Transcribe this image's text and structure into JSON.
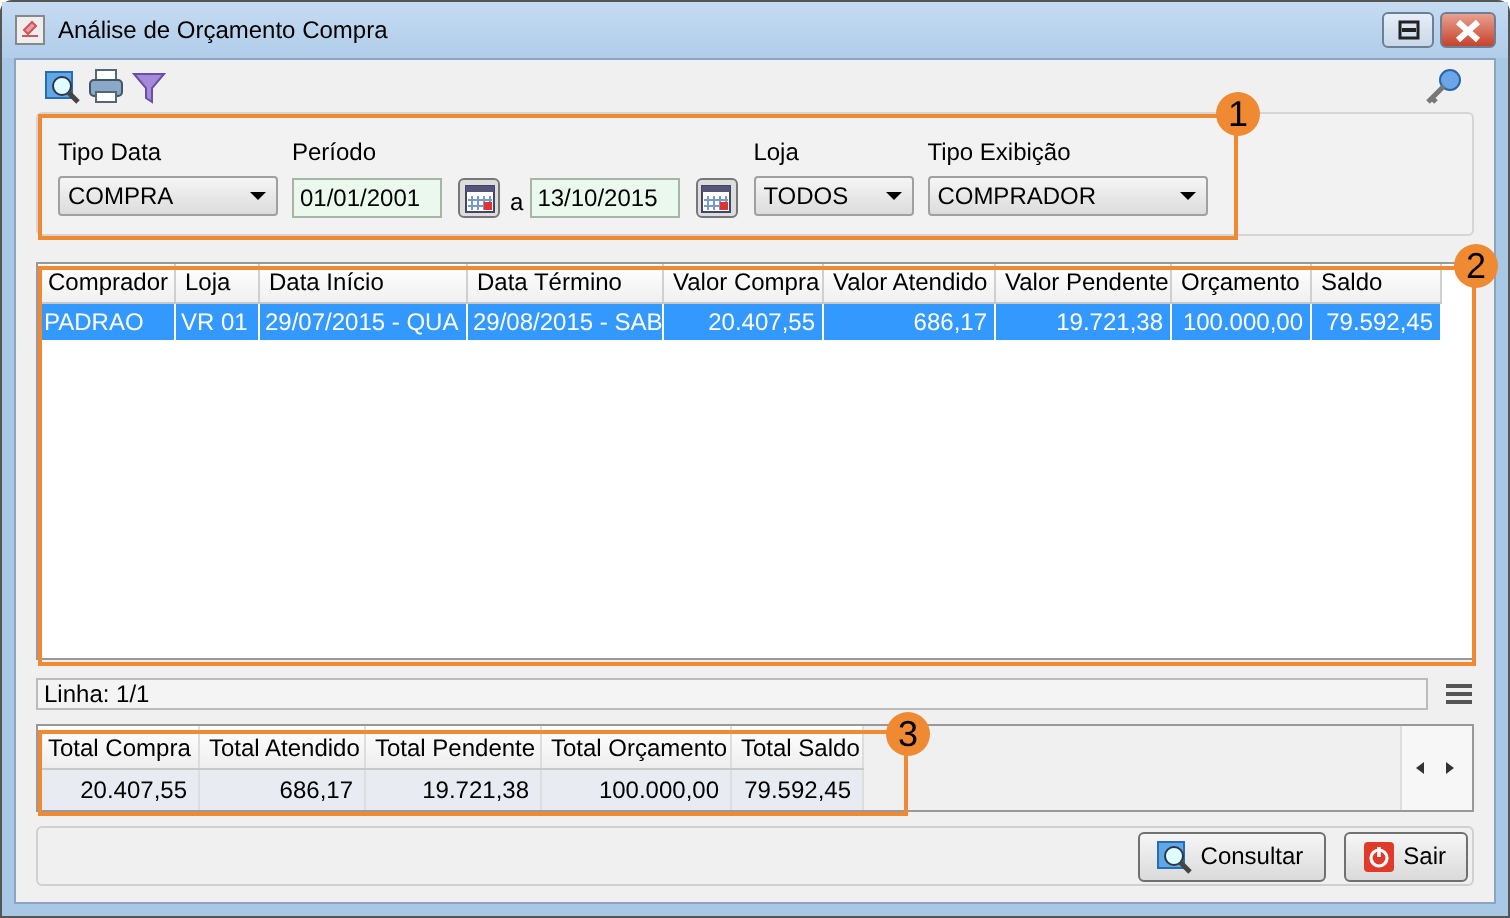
{
  "window": {
    "title": "Análise de Orçamento Compra"
  },
  "filters": [
    {
      "kind": "select",
      "label": "Tipo Data",
      "value": "COMPRA"
    },
    {
      "kind": "period",
      "label": "Período",
      "from": "01/01/2001",
      "separator": "a",
      "to": "13/10/2015"
    },
    {
      "kind": "select",
      "label": "Loja",
      "value": "TODOS"
    },
    {
      "kind": "select",
      "label": "Tipo Exibição",
      "value": "COMPRADOR"
    }
  ],
  "table": {
    "columns": [
      {
        "label": "Comprador",
        "kind": "text"
      },
      {
        "label": "Loja",
        "kind": "text"
      },
      {
        "label": "Data Início",
        "kind": "text"
      },
      {
        "label": "Data Término",
        "kind": "text"
      },
      {
        "label": "Valor Compra",
        "kind": "number"
      },
      {
        "label": "Valor Atendido",
        "kind": "number"
      },
      {
        "label": "Valor Pendente",
        "kind": "number"
      },
      {
        "label": "Orçamento",
        "kind": "number"
      },
      {
        "label": "Saldo",
        "kind": "number"
      }
    ],
    "rows": [
      {
        "selected": true,
        "cells": [
          "PADRAO",
          "VR 01",
          "29/07/2015 - QUA",
          "29/08/2015 - SAB",
          "20.407,55",
          "686,17",
          "19.721,38",
          "100.000,00",
          "79.592,45"
        ]
      }
    ]
  },
  "status_bar": {
    "text": "Linha: 1/1"
  },
  "totals": {
    "columns": [
      "Total Compra",
      "Total Atendido",
      "Total Pendente",
      "Total Orçamento",
      "Total Saldo"
    ],
    "values": [
      "20.407,55",
      "686,17",
      "19.721,38",
      "100.000,00",
      "79.592,45"
    ]
  },
  "buttons": [
    {
      "kind": "search",
      "label": "Consultar"
    },
    {
      "kind": "exit",
      "label": "Sair"
    }
  ],
  "annotations": [
    "1",
    "2",
    "3"
  ]
}
